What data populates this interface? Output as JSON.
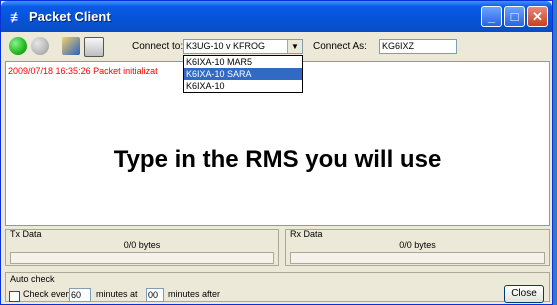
{
  "window": {
    "title": "Packet Client",
    "minimize_glyph": "_",
    "maximize_glyph": "□",
    "close_glyph": "✕"
  },
  "toolbar": {
    "connect_to_label": "Connect to:",
    "connect_to_value": "K3UG-10 v KFROG",
    "connect_to_options": [
      "K6IXA-10 MAR5",
      "K6IXA-10 SARA",
      "K6IXA-10"
    ],
    "connect_to_highlighted": 1,
    "connect_as_label": "Connect As:",
    "connect_as_value": "KG6IXZ",
    "icons": [
      "green-status-icon",
      "stop-icon",
      "edit-icon",
      "print-icon"
    ],
    "colors": {
      "status_green": "#1fb81f"
    }
  },
  "log": {
    "line": "2009/07/18 16:35:26 Packet initializat",
    "color": "#ff0000"
  },
  "overlay": {
    "caption": "Type in the RMS you will use"
  },
  "tx": {
    "label": "Tx Data",
    "value": "0/0 bytes"
  },
  "rx": {
    "label": "Rx Data",
    "value": "0/0 bytes"
  },
  "auto_check": {
    "title": "Auto check",
    "check_label": "Check every",
    "every_value": "60",
    "minutes_at_label": "minutes at",
    "at_value": "00",
    "minutes_after_label": "minutes after"
  },
  "close_button": "Close"
}
